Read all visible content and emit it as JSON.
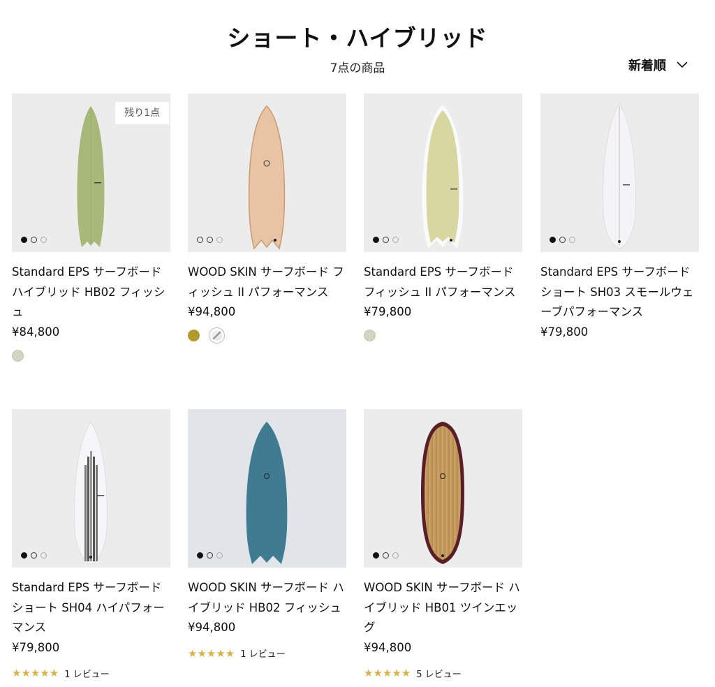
{
  "header": {
    "title": "ショート・ハイブリッド",
    "count": "7点の商品",
    "sort_label": "新着順",
    "sort_icon": "chevron-down-icon"
  },
  "products": [
    {
      "name": "Standard EPS サーフボード ハイブリッド HB02 フィッシュ",
      "price": "¥84,800",
      "badge": "残り1点",
      "board_color": "#a8b878",
      "background": "#ececec",
      "swatches": [
        {
          "color": "#d3d4c2",
          "name": "sage"
        }
      ],
      "reviews": null
    },
    {
      "name": "WOOD SKIN サーフボード フィッシュ II パフォーマンス",
      "price": "¥94,800",
      "badge": null,
      "board_color": "#e9c4a4",
      "background": "#ececec",
      "swatches": [
        {
          "color": "#b29a2c",
          "name": "olive"
        },
        {
          "color": "natural",
          "name": "natural"
        }
      ],
      "reviews": null
    },
    {
      "name": "Standard EPS サーフボード フィッシュ II パフォーマンス",
      "price": "¥79,800",
      "badge": null,
      "board_color": "#d8d7a2",
      "background": "#ececec",
      "swatches": [
        {
          "color": "#d3d4c2",
          "name": "sage"
        }
      ],
      "reviews": null
    },
    {
      "name": "Standard EPS サーフボード ショート SH03 スモールウェーブパフォーマンス",
      "price": "¥79,800",
      "badge": null,
      "board_color": "#f4f4f6",
      "background": "#ececec",
      "swatches": [],
      "reviews": null
    },
    {
      "name": "Standard EPS サーフボード ショート SH04 ハイパフォーマンス",
      "price": "¥79,800",
      "badge": null,
      "board_color": "#f6f6f8",
      "background": "#ececec",
      "swatches": [],
      "reviews": {
        "stars": "★★★★★",
        "text": "1 レビュー"
      }
    },
    {
      "name": "WOOD SKIN サーフボード ハイブリッド HB02 フィッシュ",
      "price": "¥94,800",
      "badge": null,
      "board_color": "#3f7c92",
      "background": "#e1e5e9",
      "swatches": [],
      "reviews": {
        "stars": "★★★★★",
        "text": "1 レビュー"
      }
    },
    {
      "name": "WOOD SKIN サーフボード ハイブリッド HB01 ツインエッグ",
      "price": "¥94,800",
      "badge": null,
      "board_color": "#c49a5e",
      "background": "#ececec",
      "swatches": [],
      "reviews": {
        "stars": "★★★★★",
        "text": "5 レビュー"
      }
    }
  ],
  "colors": {
    "star": "#d8b24a",
    "text": "#111111"
  }
}
